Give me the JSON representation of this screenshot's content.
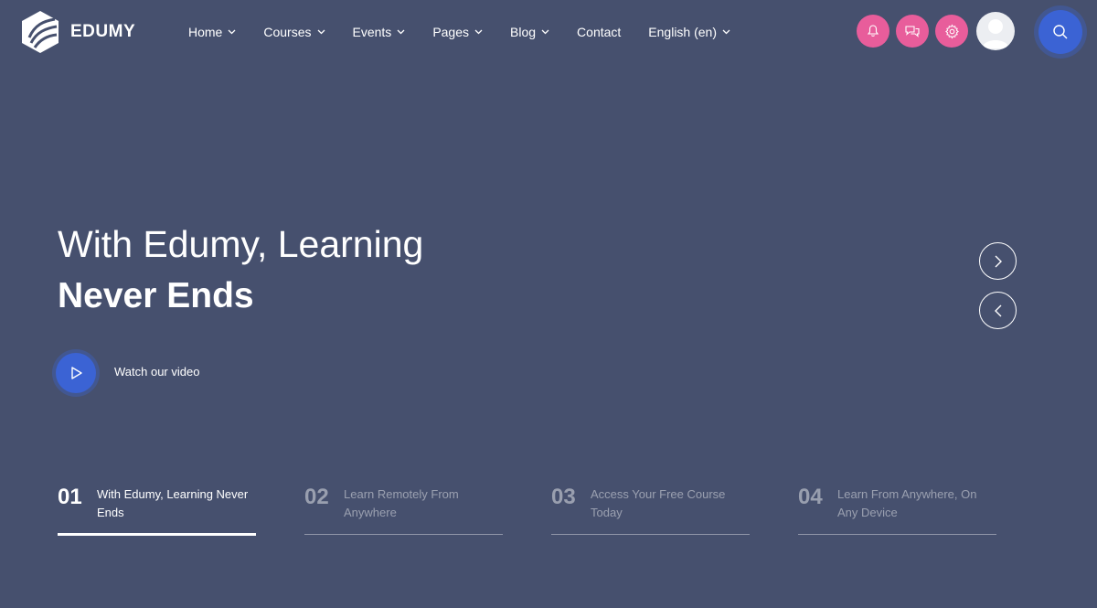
{
  "brand": {
    "name": "EDUMY"
  },
  "nav": {
    "items": [
      {
        "label": "Home",
        "has_dropdown": true
      },
      {
        "label": "Courses",
        "has_dropdown": true
      },
      {
        "label": "Events",
        "has_dropdown": true
      },
      {
        "label": "Pages",
        "has_dropdown": true
      },
      {
        "label": "Blog",
        "has_dropdown": true
      },
      {
        "label": "Contact",
        "has_dropdown": false
      },
      {
        "label": "English (en)",
        "has_dropdown": true
      }
    ]
  },
  "header_icons": [
    {
      "icon": "bell-icon"
    },
    {
      "icon": "chat-icon"
    },
    {
      "icon": "gear-icon"
    }
  ],
  "hero": {
    "line1": "With Edumy, Learning",
    "line2": "Never Ends",
    "video_label": "Watch our video"
  },
  "slides": [
    {
      "num": "01",
      "text": "With Edumy, Learning Never Ends",
      "active": true
    },
    {
      "num": "02",
      "text": "Learn Remotely From Anywhere",
      "active": false
    },
    {
      "num": "03",
      "text": "Access Your Free Course Today",
      "active": false
    },
    {
      "num": "04",
      "text": "Learn From Anywhere, On Any Device",
      "active": false
    }
  ],
  "colors": {
    "background": "#46506e",
    "accent_pink": "#e85d9b",
    "accent_blue": "#3b63d4"
  }
}
